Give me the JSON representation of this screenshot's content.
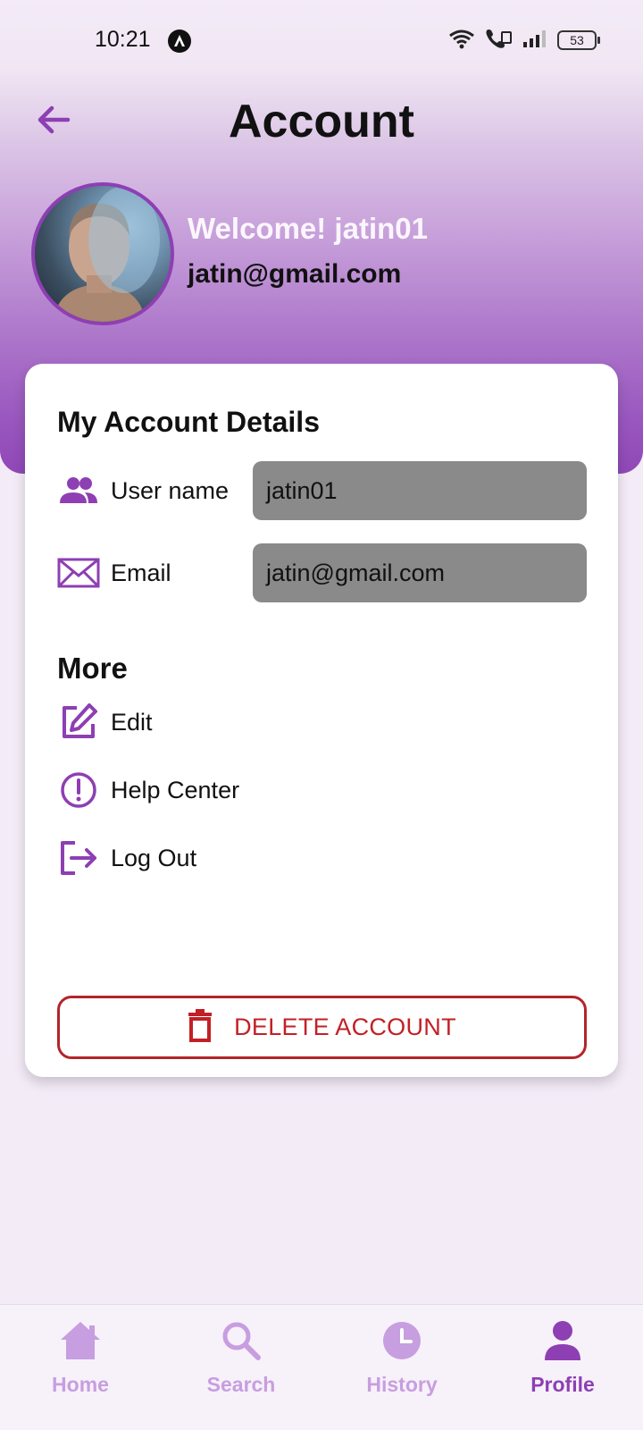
{
  "status_bar": {
    "time": "10:21",
    "battery": "53"
  },
  "header": {
    "title": "Account"
  },
  "profile": {
    "welcome": "Welcome! jatin01",
    "email": "jatin@gmail.com"
  },
  "card": {
    "title": "My Account Details",
    "fields": [
      {
        "label": "User name",
        "value": "jatin01",
        "icon": "users-icon"
      },
      {
        "label": "Email",
        "value": "jatin@gmail.com",
        "icon": "mail-icon"
      }
    ],
    "more_title": "More",
    "menu": [
      {
        "label": "Edit",
        "icon": "edit-icon"
      },
      {
        "label": "Help Center",
        "icon": "alert-circle-icon"
      },
      {
        "label": "Log Out",
        "icon": "logout-icon"
      }
    ],
    "delete_label": "DELETE ACCOUNT"
  },
  "nav": {
    "items": [
      {
        "label": "Home",
        "icon": "home-icon"
      },
      {
        "label": "Search",
        "icon": "search-icon"
      },
      {
        "label": "History",
        "icon": "clock-icon"
      },
      {
        "label": "Profile",
        "icon": "person-icon"
      }
    ],
    "active": "Profile"
  },
  "colors": {
    "accent": "#8d3fb3",
    "accent_light": "#c79ee0",
    "danger": "#c22026",
    "field_bg": "#8a8a8a"
  }
}
